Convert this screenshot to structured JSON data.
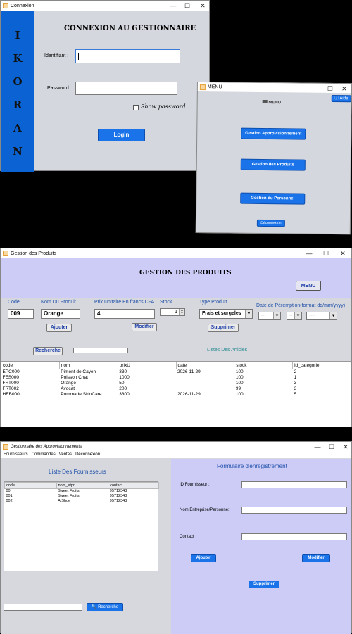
{
  "login": {
    "title": "Connexion",
    "brand_letters": [
      "I",
      "K",
      "O",
      "R",
      "A",
      "N"
    ],
    "heading": "CONNEXION AU GESTIONNAIRE",
    "id_label": "Identifiant :",
    "password_label": "Password :",
    "show_password": "Show password",
    "login_button": "Login"
  },
  "menu": {
    "title": "MENU",
    "aide_button": "Aide",
    "header": "MENU",
    "btn_approvisionnement": "Gestion Approvisionnement",
    "btn_produits": "Gestion des Produits",
    "btn_personnel": "Gestion du Personnel",
    "btn_deconnexion": "Déconnexion"
  },
  "produits": {
    "title": "Gestion des Produits",
    "heading": "GESTION DES PRODUITS",
    "menu_button": "MENU",
    "labels": {
      "code": "Code",
      "nom": "Nom Du Produit",
      "prix": "Prix Unitaire En francs CFA",
      "stock": "Stock",
      "type": "Type Produit",
      "date": "Date de Péremption(format dd/mm/yyyy)"
    },
    "values": {
      "code": "009",
      "nom": "Orange",
      "prix": "4",
      "stock": "1",
      "type": "Frais et surgeles",
      "day": "--",
      "month": "--",
      "year": "----"
    },
    "buttons": {
      "ajouter": "Ajouter",
      "modifier": "Modifier",
      "supprimer": "Supprimer",
      "recherche": "Recherche"
    },
    "list_title": "Listes Des Articles",
    "table": {
      "headers": [
        "code",
        "nom",
        "prixU",
        "date",
        "stock",
        "id_categorie"
      ],
      "rows": [
        [
          "EPC000",
          "Piment de Cayen",
          "330",
          "2026-11-29",
          "100",
          "2"
        ],
        [
          "FES000",
          "Poisson Chat",
          "1000",
          "",
          "100",
          "1"
        ],
        [
          "FRT000",
          "Orange",
          "50",
          "",
          "100",
          "3"
        ],
        [
          "FRT002",
          "Avocat",
          "200",
          "",
          "99",
          "3"
        ],
        [
          "HEB000",
          "Pommade SkinCare",
          "3300",
          "2026-11-29",
          "100",
          "5"
        ]
      ]
    }
  },
  "appro": {
    "title": "Gestionnaire des Approvisionnements",
    "menubar": [
      "Fournisseurs",
      "Commandes",
      "Ventes",
      "Déconnexion"
    ],
    "list_title": "Liste Des Fournisseurs",
    "table": {
      "headers": [
        "code",
        "nom_etpr",
        "contact"
      ],
      "rows": [
        [
          "00",
          "Sweet Fruits",
          "95712343"
        ],
        [
          "001",
          "Sweet Fruits",
          "95712343"
        ],
        [
          "002",
          "A.Shoe",
          "95712343"
        ]
      ]
    },
    "recherche_button": "Recherche",
    "form_title": "Formulaire d'enregistrement",
    "labels": {
      "id": "ID Fournisseur :",
      "nom": "Nom Entreprise/Personne:",
      "contact": "Contact :"
    },
    "buttons": {
      "ajouter": "Ajouter",
      "modifier": "Modifier",
      "supprimer": "Supprimer"
    }
  }
}
